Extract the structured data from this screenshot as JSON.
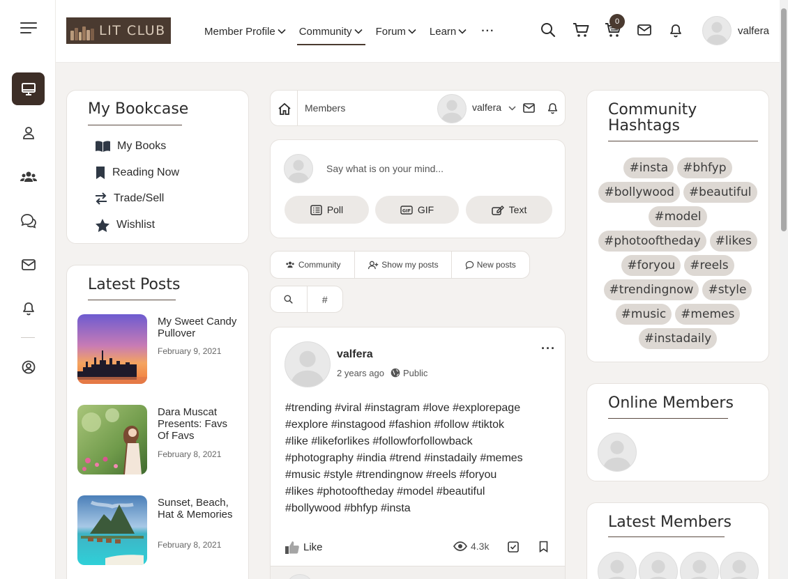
{
  "brand": {
    "logo_text": "LIT CLUB"
  },
  "nav": {
    "items": [
      {
        "label": "Member Profile"
      },
      {
        "label": "Community"
      },
      {
        "label": "Forum"
      },
      {
        "label": "Learn"
      }
    ],
    "more": "···"
  },
  "header": {
    "cart_count": "0",
    "username": "valfera"
  },
  "bookcase": {
    "title": "My Bookcase",
    "items": [
      {
        "label": "My Books",
        "icon": "open-book-icon"
      },
      {
        "label": "Reading Now",
        "icon": "bookmark-icon"
      },
      {
        "label": "Trade/Sell",
        "icon": "swap-arrows-icon"
      },
      {
        "label": "Wishlist",
        "icon": "star-icon"
      }
    ]
  },
  "latest_posts": {
    "title": "Latest Posts",
    "posts": [
      {
        "title": "My Sweet Candy Pullover",
        "date": "February 9, 2021"
      },
      {
        "title": "Dara Muscat Presents: Favs Of Favs",
        "date": "February 8, 2021"
      },
      {
        "title": "Sunset, Beach, Hat & Memories",
        "date": "February 8, 2021"
      }
    ]
  },
  "activity_header": {
    "breadcrumb": "Members",
    "username": "valfera"
  },
  "composer": {
    "placeholder": "Say what is on your mind...",
    "buttons": {
      "poll": "Poll",
      "gif": "GIF",
      "text": "Text"
    }
  },
  "filters": {
    "community": "Community",
    "show_my_posts": "Show my posts",
    "new_posts": "New posts",
    "hash": "#"
  },
  "post": {
    "author": "valfera",
    "time": "2 years ago",
    "visibility": "Public",
    "lines": [
      "#trending #viral #instagram #love #explorepage",
      "#explore #instagood #fashion #follow #tiktok",
      "#like #likeforlikes #followforfollowback",
      "#photography #india #trend #instadaily #memes",
      "#music #style #trendingnow #reels #foryou",
      "#likes #photooftheday #model #beautiful",
      "#bollywood #bhfyp #insta"
    ],
    "like_label": "Like",
    "views": "4.3k"
  },
  "community_hashtags": {
    "title_line1": "Community",
    "title_line2": "Hashtags",
    "tags": [
      "#insta",
      "#bhfyp",
      "#bollywood",
      "#beautiful",
      "#model",
      "#photooftheday",
      "#likes",
      "#foryou",
      "#reels",
      "#trendingnow",
      "#style",
      "#music",
      "#memes",
      "#instadaily"
    ]
  },
  "online_members": {
    "title": "Online Members"
  },
  "latest_members": {
    "title": "Latest Members"
  },
  "colors": {
    "accent": "#3d2e27",
    "chip": "#ddd8d3",
    "background": "#f4f2f0"
  }
}
